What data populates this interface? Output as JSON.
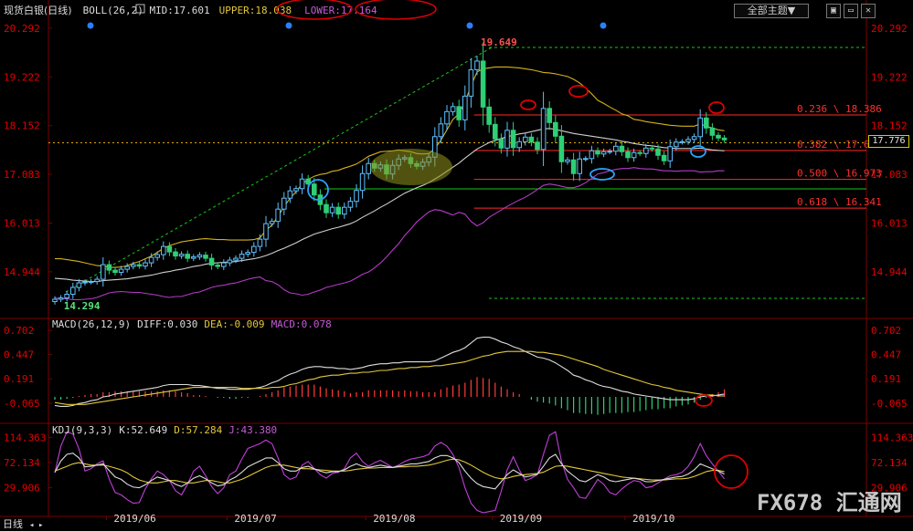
{
  "header": {
    "boll_prefix": "现货白银",
    "boll_period": "(日线)",
    "boll_text": "BOLL(26,2) MID:17.601",
    "boll_upper": "UPPER:18.038",
    "boll_lower": "LOWER:17.164",
    "theme_button": "全部主题▼",
    "win_buttons": [
      "▣",
      "▭",
      "✕"
    ]
  },
  "macd_legend": {
    "name": "MACD(26,12,9)",
    "diff": "DIFF:0.030",
    "dea": "DEA:-0.009",
    "macd": "MACD:0.078"
  },
  "kdj_legend": {
    "name": "KDJ(9,3,3)",
    "k": "K:52.649",
    "d": "D:57.284",
    "j": "J:43.380"
  },
  "bottom": {
    "period_label": "日线",
    "watermark": "FX678 汇通网"
  },
  "current_price": "17.776",
  "colors": {
    "up": "#5ec1ff",
    "down": "#2ecf75",
    "background": "#000000",
    "axis_text": "#e60000"
  },
  "chart_data": [
    {
      "type": "candlestick",
      "panel": "price",
      "y_ticks": [
        20.292,
        19.222,
        18.152,
        17.083,
        16.013,
        14.944
      ],
      "ylim": [
        13.98,
        20.55
      ],
      "x_ticks": [
        "2019/06",
        "2019/07",
        "2019/08",
        "2019/09",
        "2019/10"
      ],
      "extreme_labels": {
        "high": "19.649",
        "low": "14.294"
      },
      "fib_levels": [
        {
          "label": "0.236 \\ 18.386",
          "value": 18.386
        },
        {
          "label": "0.382 \\ 17.605",
          "value": 17.605
        },
        {
          "label": "0.500 \\ 16.973",
          "value": 16.973
        },
        {
          "label": "0.618 \\ 16.341",
          "value": 16.341
        }
      ],
      "close": [
        14.34,
        14.37,
        14.45,
        14.6,
        14.7,
        14.72,
        14.73,
        14.78,
        15.1,
        14.98,
        14.93,
        15.0,
        15.06,
        15.1,
        15.07,
        15.14,
        15.26,
        15.32,
        15.5,
        15.38,
        15.29,
        15.33,
        15.24,
        15.27,
        15.31,
        15.24,
        15.09,
        15.06,
        15.14,
        15.2,
        15.24,
        15.33,
        15.37,
        15.5,
        15.66,
        16.0,
        16.05,
        16.32,
        16.56,
        16.72,
        16.77,
        16.98,
        16.87,
        16.63,
        16.42,
        16.24,
        16.36,
        16.21,
        16.36,
        16.49,
        16.73,
        17.1,
        17.32,
        17.22,
        17.29,
        17.09,
        17.28,
        17.42,
        17.45,
        17.32,
        17.26,
        17.35,
        17.46,
        17.91,
        18.19,
        18.46,
        18.57,
        18.28,
        18.8,
        19.38,
        19.57,
        18.56,
        18.18,
        17.86,
        17.66,
        18.05,
        17.67,
        17.8,
        17.9,
        17.79,
        17.63,
        18.53,
        18.22,
        17.92,
        17.36,
        17.4,
        17.1,
        17.42,
        17.43,
        17.6,
        17.53,
        17.58,
        17.59,
        17.7,
        17.58,
        17.45,
        17.56,
        17.54,
        17.66,
        17.64,
        17.5,
        17.38,
        17.69,
        17.79,
        17.8,
        17.85,
        17.91,
        18.32,
        18.1,
        17.94,
        17.88,
        17.84
      ],
      "boll_mid": [
        14.8,
        14.79,
        14.78,
        14.76,
        14.75,
        14.74,
        14.73,
        14.73,
        14.75,
        14.76,
        14.77,
        14.78,
        14.79,
        14.81,
        14.83,
        14.85,
        14.87,
        14.9,
        14.93,
        14.95,
        14.98,
        15.0,
        15.03,
        15.06,
        15.08,
        15.11,
        15.13,
        15.14,
        15.15,
        15.16,
        15.17,
        15.19,
        15.21,
        15.23,
        15.26,
        15.3,
        15.35,
        15.41,
        15.46,
        15.52,
        15.58,
        15.65,
        15.71,
        15.77,
        15.81,
        15.85,
        15.89,
        15.92,
        15.96,
        16.0,
        16.06,
        16.14,
        16.21,
        16.28,
        16.36,
        16.43,
        16.51,
        16.59,
        16.67,
        16.73,
        16.79,
        16.84,
        16.9,
        16.98,
        17.06,
        17.15,
        17.24,
        17.33,
        17.44,
        17.54,
        17.64,
        17.71,
        17.78,
        17.83,
        17.87,
        17.91,
        17.94,
        17.97,
        17.99,
        18.02,
        18.05,
        18.08,
        18.09,
        18.07,
        18.04,
        18.01,
        17.98,
        17.96,
        17.94,
        17.92,
        17.9,
        17.88,
        17.86,
        17.84,
        17.81,
        17.79,
        17.76,
        17.74,
        17.72,
        17.71,
        17.69,
        17.67,
        17.66,
        17.65,
        17.65,
        17.65,
        17.65,
        17.66,
        17.64,
        17.62,
        17.61,
        17.6
      ],
      "boll_upper": [
        15.23,
        15.23,
        15.21,
        15.19,
        15.17,
        15.14,
        15.11,
        15.08,
        15.07,
        15.04,
        15.04,
        15.05,
        15.08,
        15.13,
        15.17,
        15.23,
        15.29,
        15.37,
        15.46,
        15.52,
        15.56,
        15.6,
        15.62,
        15.64,
        15.66,
        15.67,
        15.66,
        15.65,
        15.65,
        15.64,
        15.64,
        15.64,
        15.64,
        15.65,
        15.69,
        15.85,
        15.97,
        16.16,
        16.37,
        16.56,
        16.7,
        16.87,
        16.97,
        17.04,
        17.08,
        17.1,
        17.15,
        17.17,
        17.22,
        17.26,
        17.31,
        17.39,
        17.48,
        17.53,
        17.58,
        17.59,
        17.6,
        17.62,
        17.6,
        17.58,
        17.54,
        17.53,
        17.54,
        17.65,
        17.83,
        18.06,
        18.29,
        18.41,
        18.67,
        19.03,
        19.33,
        19.4,
        19.42,
        19.44,
        19.44,
        19.44,
        19.43,
        19.42,
        19.4,
        19.38,
        19.35,
        19.32,
        19.31,
        19.29,
        19.26,
        19.23,
        19.17,
        19.09,
        18.98,
        18.85,
        18.71,
        18.64,
        18.56,
        18.49,
        18.41,
        18.37,
        18.29,
        18.27,
        18.24,
        18.22,
        18.2,
        18.18,
        18.16,
        18.15,
        18.14,
        18.14,
        18.14,
        18.19,
        18.14,
        18.1,
        18.06,
        18.04
      ],
      "boll_lower": [
        14.37,
        14.35,
        14.35,
        14.33,
        14.33,
        14.34,
        14.35,
        14.38,
        14.43,
        14.48,
        14.5,
        14.51,
        14.5,
        14.49,
        14.49,
        14.47,
        14.45,
        14.43,
        14.4,
        14.38,
        14.4,
        14.4,
        14.44,
        14.48,
        14.5,
        14.55,
        14.6,
        14.63,
        14.65,
        14.68,
        14.7,
        14.74,
        14.78,
        14.81,
        14.83,
        14.75,
        14.73,
        14.66,
        14.55,
        14.48,
        14.46,
        14.43,
        14.45,
        14.5,
        14.54,
        14.6,
        14.63,
        14.67,
        14.7,
        14.74,
        14.81,
        14.89,
        14.94,
        15.03,
        15.14,
        15.27,
        15.42,
        15.56,
        15.74,
        15.88,
        16.04,
        16.15,
        16.26,
        16.31,
        16.29,
        16.24,
        16.19,
        16.25,
        16.21,
        16.05,
        15.95,
        16.02,
        16.14,
        16.22,
        16.3,
        16.38,
        16.45,
        16.52,
        16.58,
        16.66,
        16.75,
        16.84,
        16.87,
        16.85,
        16.82,
        16.79,
        16.79,
        16.83,
        16.9,
        16.99,
        17.09,
        17.12,
        17.16,
        17.19,
        17.21,
        17.21,
        17.23,
        17.21,
        17.2,
        17.2,
        17.18,
        17.16,
        17.16,
        17.15,
        17.16,
        17.16,
        17.16,
        17.13,
        17.14,
        17.14,
        17.16,
        17.16
      ]
    },
    {
      "type": "bar",
      "panel": "macd",
      "y_ticks": [
        0.702,
        0.447,
        0.191,
        -0.065
      ],
      "ylim": [
        -0.26,
        0.8
      ],
      "diff": [
        -0.09,
        -0.1,
        -0.1,
        -0.09,
        -0.07,
        -0.06,
        -0.04,
        -0.03,
        0.0,
        0.01,
        0.03,
        0.04,
        0.05,
        0.06,
        0.07,
        0.08,
        0.09,
        0.1,
        0.12,
        0.13,
        0.13,
        0.13,
        0.13,
        0.12,
        0.12,
        0.11,
        0.1,
        0.09,
        0.09,
        0.08,
        0.08,
        0.08,
        0.08,
        0.09,
        0.1,
        0.12,
        0.15,
        0.17,
        0.21,
        0.24,
        0.26,
        0.29,
        0.31,
        0.32,
        0.32,
        0.31,
        0.31,
        0.3,
        0.3,
        0.29,
        0.3,
        0.31,
        0.33,
        0.34,
        0.35,
        0.35,
        0.36,
        0.36,
        0.37,
        0.37,
        0.37,
        0.37,
        0.37,
        0.38,
        0.41,
        0.44,
        0.47,
        0.49,
        0.52,
        0.57,
        0.62,
        0.63,
        0.63,
        0.61,
        0.58,
        0.56,
        0.53,
        0.51,
        0.48,
        0.45,
        0.42,
        0.41,
        0.39,
        0.36,
        0.32,
        0.28,
        0.23,
        0.21,
        0.18,
        0.16,
        0.13,
        0.11,
        0.1,
        0.08,
        0.06,
        0.05,
        0.03,
        0.02,
        0.01,
        0.0,
        -0.01,
        -0.02,
        -0.03,
        -0.03,
        -0.03,
        -0.03,
        -0.02,
        0.0,
        0.01,
        0.01,
        0.02,
        0.03
      ],
      "dea": [
        -0.06,
        -0.07,
        -0.08,
        -0.08,
        -0.08,
        -0.08,
        -0.07,
        -0.06,
        -0.05,
        -0.04,
        -0.03,
        -0.02,
        -0.01,
        0.0,
        0.01,
        0.02,
        0.03,
        0.04,
        0.05,
        0.06,
        0.07,
        0.08,
        0.09,
        0.1,
        0.1,
        0.1,
        0.1,
        0.1,
        0.1,
        0.1,
        0.1,
        0.09,
        0.09,
        0.09,
        0.09,
        0.09,
        0.1,
        0.1,
        0.11,
        0.13,
        0.14,
        0.16,
        0.18,
        0.19,
        0.21,
        0.22,
        0.23,
        0.23,
        0.24,
        0.25,
        0.25,
        0.26,
        0.26,
        0.27,
        0.28,
        0.28,
        0.29,
        0.3,
        0.3,
        0.31,
        0.31,
        0.32,
        0.32,
        0.33,
        0.33,
        0.34,
        0.35,
        0.36,
        0.37,
        0.39,
        0.41,
        0.43,
        0.44,
        0.46,
        0.47,
        0.48,
        0.48,
        0.48,
        0.48,
        0.48,
        0.47,
        0.47,
        0.46,
        0.45,
        0.44,
        0.42,
        0.4,
        0.38,
        0.36,
        0.34,
        0.32,
        0.29,
        0.27,
        0.25,
        0.23,
        0.21,
        0.19,
        0.17,
        0.15,
        0.13,
        0.12,
        0.1,
        0.09,
        0.07,
        0.06,
        0.05,
        0.04,
        0.03,
        0.02,
        0.02,
        0.01,
        0.01
      ],
      "macd": [
        -0.03,
        -0.03,
        -0.02,
        -0.01,
        0.01,
        0.02,
        0.03,
        0.03,
        0.05,
        0.05,
        0.06,
        0.06,
        0.06,
        0.06,
        0.06,
        0.06,
        0.06,
        0.06,
        0.07,
        0.07,
        0.06,
        0.05,
        0.04,
        0.02,
        0.02,
        0.01,
        0.0,
        -0.01,
        -0.01,
        -0.02,
        -0.02,
        -0.01,
        -0.01,
        0.0,
        0.01,
        0.03,
        0.05,
        0.07,
        0.1,
        0.11,
        0.12,
        0.13,
        0.13,
        0.13,
        0.11,
        0.09,
        0.08,
        0.07,
        0.06,
        0.04,
        0.05,
        0.05,
        0.07,
        0.07,
        0.07,
        0.07,
        0.07,
        0.06,
        0.07,
        0.06,
        0.06,
        0.05,
        0.05,
        0.05,
        0.08,
        0.1,
        0.12,
        0.13,
        0.15,
        0.18,
        0.21,
        0.2,
        0.19,
        0.15,
        0.11,
        0.08,
        0.05,
        0.03,
        0.0,
        -0.03,
        -0.05,
        -0.06,
        -0.07,
        -0.09,
        -0.12,
        -0.14,
        -0.17,
        -0.17,
        -0.18,
        -0.18,
        -0.19,
        -0.18,
        -0.17,
        -0.17,
        -0.17,
        -0.16,
        -0.16,
        -0.15,
        -0.14,
        -0.13,
        -0.13,
        -0.12,
        -0.12,
        -0.1,
        -0.09,
        -0.08,
        -0.06,
        -0.03,
        -0.01,
        0.03,
        0.05,
        0.08
      ]
    },
    {
      "type": "line",
      "panel": "kdj",
      "y_ticks": [
        114.363,
        72.134,
        29.906
      ],
      "ylim": [
        -12,
        135
      ],
      "k": [
        56,
        75,
        86,
        88,
        80,
        65,
        66,
        68,
        70,
        59,
        48,
        44,
        36,
        31,
        30,
        35,
        42,
        48,
        45,
        42,
        36,
        32,
        38,
        46,
        50,
        45,
        38,
        33,
        35,
        43,
        48,
        56,
        65,
        70,
        75,
        80,
        80,
        72,
        62,
        58,
        58,
        64,
        66,
        62,
        58,
        55,
        57,
        57,
        60,
        66,
        70,
        66,
        64,
        66,
        68,
        66,
        64,
        66,
        68,
        70,
        70,
        72,
        74,
        80,
        84,
        84,
        80,
        72,
        58,
        46,
        37,
        32,
        30,
        28,
        40,
        52,
        60,
        54,
        48,
        50,
        53,
        66,
        80,
        86,
        70,
        58,
        50,
        42,
        40,
        46,
        52,
        48,
        42,
        40,
        42,
        44,
        46,
        44,
        40,
        40,
        42,
        44,
        46,
        48,
        49,
        53,
        60,
        70,
        66,
        62,
        58,
        53
      ],
      "d": [
        58,
        62,
        66,
        70,
        72,
        70,
        68,
        68,
        68,
        66,
        63,
        60,
        55,
        48,
        43,
        40,
        38,
        38,
        40,
        42,
        42,
        40,
        38,
        38,
        40,
        42,
        42,
        40,
        38,
        38,
        41,
        44,
        49,
        54,
        59,
        64,
        67,
        68,
        68,
        66,
        64,
        62,
        62,
        61,
        60,
        59,
        58,
        58,
        58,
        59,
        61,
        62,
        63,
        63,
        64,
        64,
        64,
        65,
        65,
        66,
        66,
        67,
        68,
        70,
        73,
        76,
        78,
        77,
        73,
        68,
        62,
        56,
        51,
        47,
        45,
        46,
        49,
        51,
        52,
        53,
        54,
        56,
        61,
        66,
        67,
        66,
        64,
        62,
        60,
        58,
        56,
        54,
        52,
        50,
        48,
        47,
        46,
        45,
        44,
        43,
        43,
        43,
        44,
        45,
        45,
        46,
        49,
        53,
        57,
        59,
        59,
        57
      ],
      "j": [
        55,
        100,
        124,
        120,
        95,
        58,
        62,
        70,
        75,
        45,
        22,
        18,
        10,
        4,
        5,
        28,
        45,
        58,
        52,
        42,
        25,
        18,
        36,
        58,
        66,
        50,
        32,
        20,
        30,
        52,
        58,
        78,
        96,
        100,
        104,
        110,
        104,
        80,
        52,
        44,
        48,
        68,
        74,
        62,
        52,
        46,
        54,
        56,
        62,
        80,
        88,
        74,
        66,
        72,
        76,
        70,
        64,
        68,
        74,
        78,
        80,
        82,
        86,
        100,
        106,
        100,
        86,
        64,
        30,
        4,
        -8,
        -12,
        -10,
        -8,
        24,
        60,
        82,
        60,
        42,
        46,
        52,
        86,
        118,
        124,
        74,
        44,
        30,
        14,
        12,
        28,
        44,
        36,
        22,
        18,
        28,
        36,
        42,
        40,
        30,
        32,
        38,
        44,
        50,
        52,
        56,
        66,
        82,
        104,
        84,
        70,
        58,
        45
      ]
    }
  ]
}
